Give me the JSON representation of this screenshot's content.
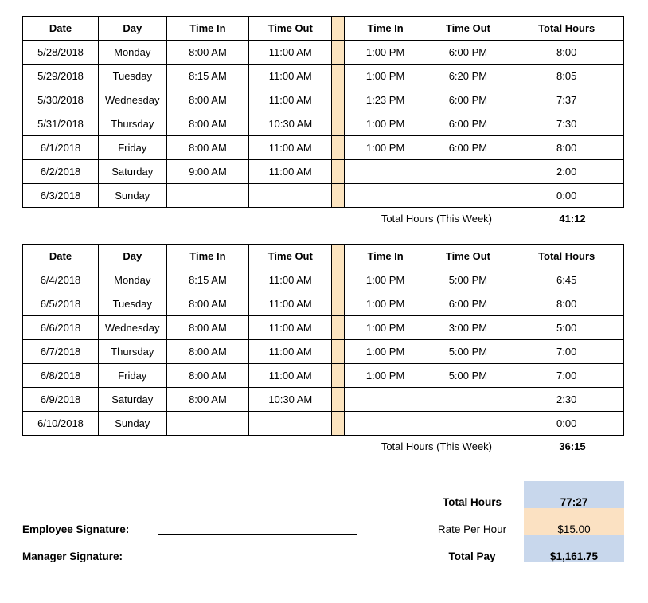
{
  "headers": {
    "date": "Date",
    "day": "Day",
    "time_in": "Time In",
    "time_out": "Time Out",
    "total_hours": "Total Hours"
  },
  "week1": {
    "rows": [
      {
        "date": "5/28/2018",
        "day": "Monday",
        "in1": "8:00 AM",
        "out1": "11:00 AM",
        "in2": "1:00 PM",
        "out2": "6:00 PM",
        "total": "8:00"
      },
      {
        "date": "5/29/2018",
        "day": "Tuesday",
        "in1": "8:15 AM",
        "out1": "11:00 AM",
        "in2": "1:00 PM",
        "out2": "6:20 PM",
        "total": "8:05"
      },
      {
        "date": "5/30/2018",
        "day": "Wednesday",
        "in1": "8:00 AM",
        "out1": "11:00 AM",
        "in2": "1:23 PM",
        "out2": "6:00 PM",
        "total": "7:37"
      },
      {
        "date": "5/31/2018",
        "day": "Thursday",
        "in1": "8:00 AM",
        "out1": "10:30 AM",
        "in2": "1:00 PM",
        "out2": "6:00 PM",
        "total": "7:30"
      },
      {
        "date": "6/1/2018",
        "day": "Friday",
        "in1": "8:00 AM",
        "out1": "11:00 AM",
        "in2": "1:00 PM",
        "out2": "6:00 PM",
        "total": "8:00"
      },
      {
        "date": "6/2/2018",
        "day": "Saturday",
        "in1": "9:00 AM",
        "out1": "11:00 AM",
        "in2": "",
        "out2": "",
        "total": "2:00"
      },
      {
        "date": "6/3/2018",
        "day": "Sunday",
        "in1": "",
        "out1": "",
        "in2": "",
        "out2": "",
        "total": "0:00"
      }
    ],
    "total_label": "Total Hours (This Week)",
    "total_value": "41:12"
  },
  "week2": {
    "rows": [
      {
        "date": "6/4/2018",
        "day": "Monday",
        "in1": "8:15 AM",
        "out1": "11:00 AM",
        "in2": "1:00 PM",
        "out2": "5:00 PM",
        "total": "6:45"
      },
      {
        "date": "6/5/2018",
        "day": "Tuesday",
        "in1": "8:00 AM",
        "out1": "11:00 AM",
        "in2": "1:00 PM",
        "out2": "6:00 PM",
        "total": "8:00"
      },
      {
        "date": "6/6/2018",
        "day": "Wednesday",
        "in1": "8:00 AM",
        "out1": "11:00 AM",
        "in2": "1:00 PM",
        "out2": "3:00 PM",
        "total": "5:00"
      },
      {
        "date": "6/7/2018",
        "day": "Thursday",
        "in1": "8:00 AM",
        "out1": "11:00 AM",
        "in2": "1:00 PM",
        "out2": "5:00 PM",
        "total": "7:00"
      },
      {
        "date": "6/8/2018",
        "day": "Friday",
        "in1": "8:00 AM",
        "out1": "11:00 AM",
        "in2": "1:00 PM",
        "out2": "5:00 PM",
        "total": "7:00"
      },
      {
        "date": "6/9/2018",
        "day": "Saturday",
        "in1": "8:00 AM",
        "out1": "10:30 AM",
        "in2": "",
        "out2": "",
        "total": "2:30"
      },
      {
        "date": "6/10/2018",
        "day": "Sunday",
        "in1": "",
        "out1": "",
        "in2": "",
        "out2": "",
        "total": "0:00"
      }
    ],
    "total_label": "Total Hours (This Week)",
    "total_value": "36:15"
  },
  "signatures": {
    "employee": "Employee Signature:",
    "manager": "Manager Signature:"
  },
  "summary": {
    "total_hours_label": "Total Hours",
    "total_hours_value": "77:27",
    "rate_label": "Rate Per Hour",
    "rate_value": "$15.00",
    "total_pay_label": "Total Pay",
    "total_pay_value": "$1,161.75"
  }
}
